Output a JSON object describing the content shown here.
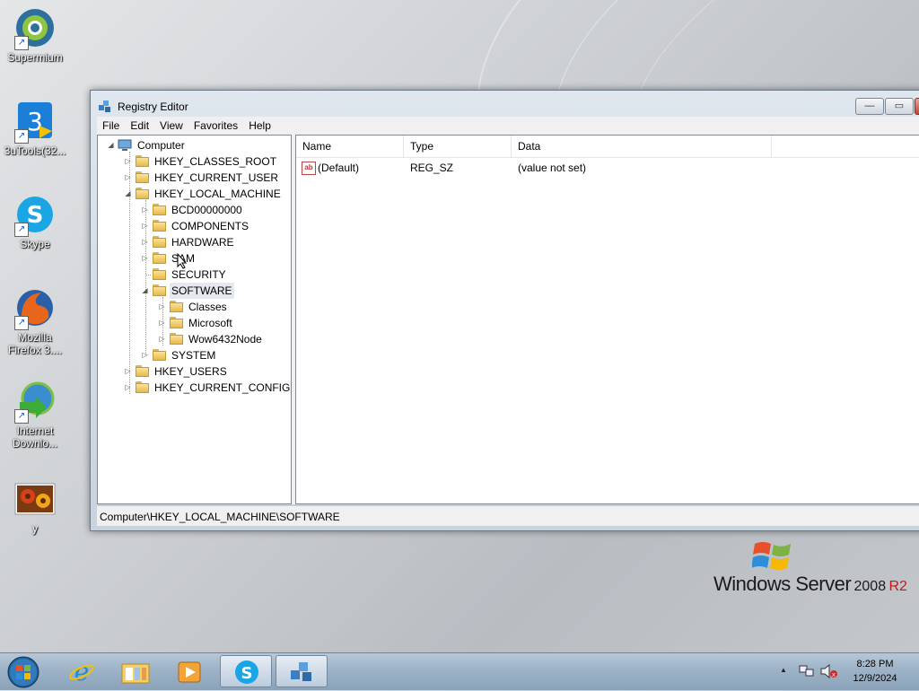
{
  "desktop": {
    "icons": [
      {
        "label": "Supermium",
        "name": "supermium"
      },
      {
        "label": "3uTools(32...",
        "name": "3utools"
      },
      {
        "label": "Skype",
        "name": "skype"
      },
      {
        "label": "Mozilla Firefox 3....",
        "name": "firefox"
      },
      {
        "label": "Internet Downlo...",
        "name": "internet-download-manager"
      },
      {
        "label": "y",
        "name": "y-image"
      }
    ],
    "branding": {
      "main": "Windows Server",
      "year": "2008",
      "edition": "R2"
    }
  },
  "window": {
    "title": "Registry Editor",
    "controls": {
      "minimize": "—",
      "maximize": "▭",
      "close": "✕"
    },
    "menu": [
      "File",
      "Edit",
      "View",
      "Favorites",
      "Help"
    ],
    "tree": [
      {
        "label": "Computer",
        "expanded": true
      },
      {
        "label": "HKEY_CLASSES_ROOT",
        "expanded": false
      },
      {
        "label": "HKEY_CURRENT_USER",
        "expanded": false
      },
      {
        "label": "HKEY_LOCAL_MACHINE",
        "expanded": true
      },
      {
        "label": "BCD00000000",
        "expanded": false
      },
      {
        "label": "COMPONENTS",
        "expanded": false
      },
      {
        "label": "HARDWARE",
        "expanded": false
      },
      {
        "label": "SAM",
        "expanded": false
      },
      {
        "label": "SECURITY",
        "expanded": false
      },
      {
        "label": "SOFTWARE",
        "expanded": true,
        "selected": true
      },
      {
        "label": "Classes",
        "expanded": false
      },
      {
        "label": "Microsoft",
        "expanded": false
      },
      {
        "label": "Wow6432Node",
        "expanded": false
      },
      {
        "label": "SYSTEM",
        "expanded": false
      },
      {
        "label": "HKEY_USERS",
        "expanded": false
      },
      {
        "label": "HKEY_CURRENT_CONFIG",
        "expanded": false
      }
    ],
    "list": {
      "columns": [
        "Name",
        "Type",
        "Data"
      ],
      "rows": [
        {
          "name": "(Default)",
          "type": "REG_SZ",
          "data": "(value not set)",
          "icon": "ab"
        }
      ]
    },
    "status": "Computer\\HKEY_LOCAL_MACHINE\\SOFTWARE"
  },
  "taskbar": {
    "apps": [
      "internet-explorer",
      "windows-explorer",
      "media-player",
      "skype",
      "registry-editor"
    ],
    "clock": {
      "time": "8:28 PM",
      "date": "12/9/2024"
    },
    "tray_arrow": "▲"
  }
}
